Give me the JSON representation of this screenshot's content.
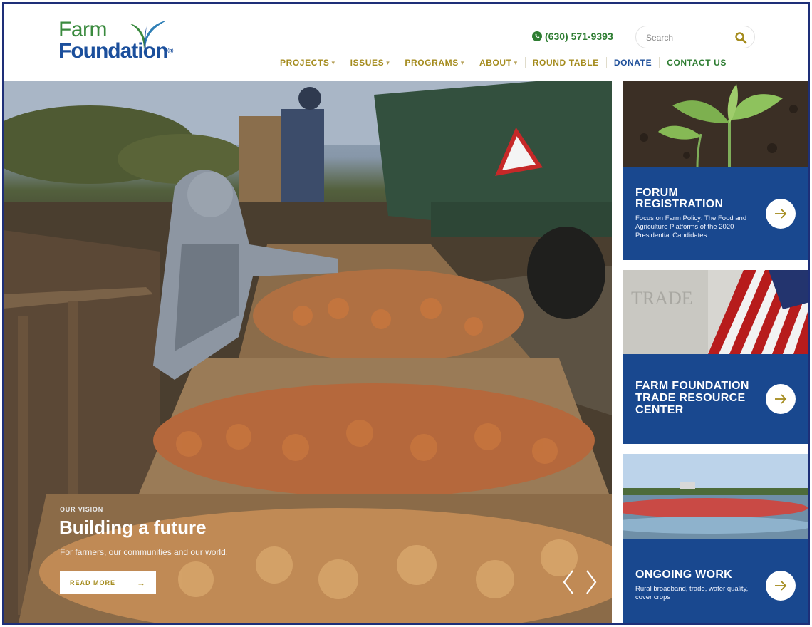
{
  "header": {
    "logo": {
      "line1": "Farm",
      "line2": "Foundation",
      "reg": "®"
    },
    "phone": "(630) 571-9393",
    "search": {
      "placeholder": "Search"
    },
    "nav": [
      {
        "label": "PROJECTS",
        "dropdown": true
      },
      {
        "label": "ISSUES",
        "dropdown": true
      },
      {
        "label": "PROGRAMS",
        "dropdown": true
      },
      {
        "label": "ABOUT",
        "dropdown": true
      },
      {
        "label": "ROUND TABLE",
        "dropdown": false
      },
      {
        "label": "DONATE",
        "dropdown": false
      },
      {
        "label": "CONTACT US",
        "dropdown": false
      }
    ]
  },
  "hero": {
    "eyebrow": "OUR VISION",
    "title": "Building a future",
    "subtitle": "For farmers, our communities and our world.",
    "button": "READ MORE"
  },
  "cards": [
    {
      "title_line1": "FORUM",
      "title_line2": "REGISTRATION",
      "text": "Focus on Farm Policy: The Food and Agriculture Platforms of the 2020 Presidential Candidates"
    },
    {
      "title_line1": "FARM FOUNDATION",
      "title_line2": "TRADE RESOURCE",
      "title_line3": "CENTER",
      "image_text": "TRADE"
    },
    {
      "title_line1": "ONGOING WORK",
      "text": "Rural broadband, trade, water quality, cover crops"
    }
  ],
  "colors": {
    "brand_green": "#2e7d32",
    "brand_blue": "#1b4f9c",
    "gold": "#a48b1d",
    "card_blue": "#19488f",
    "strip": [
      "#1b4f9c",
      "#c9a21c",
      "#2e8b3a"
    ]
  }
}
